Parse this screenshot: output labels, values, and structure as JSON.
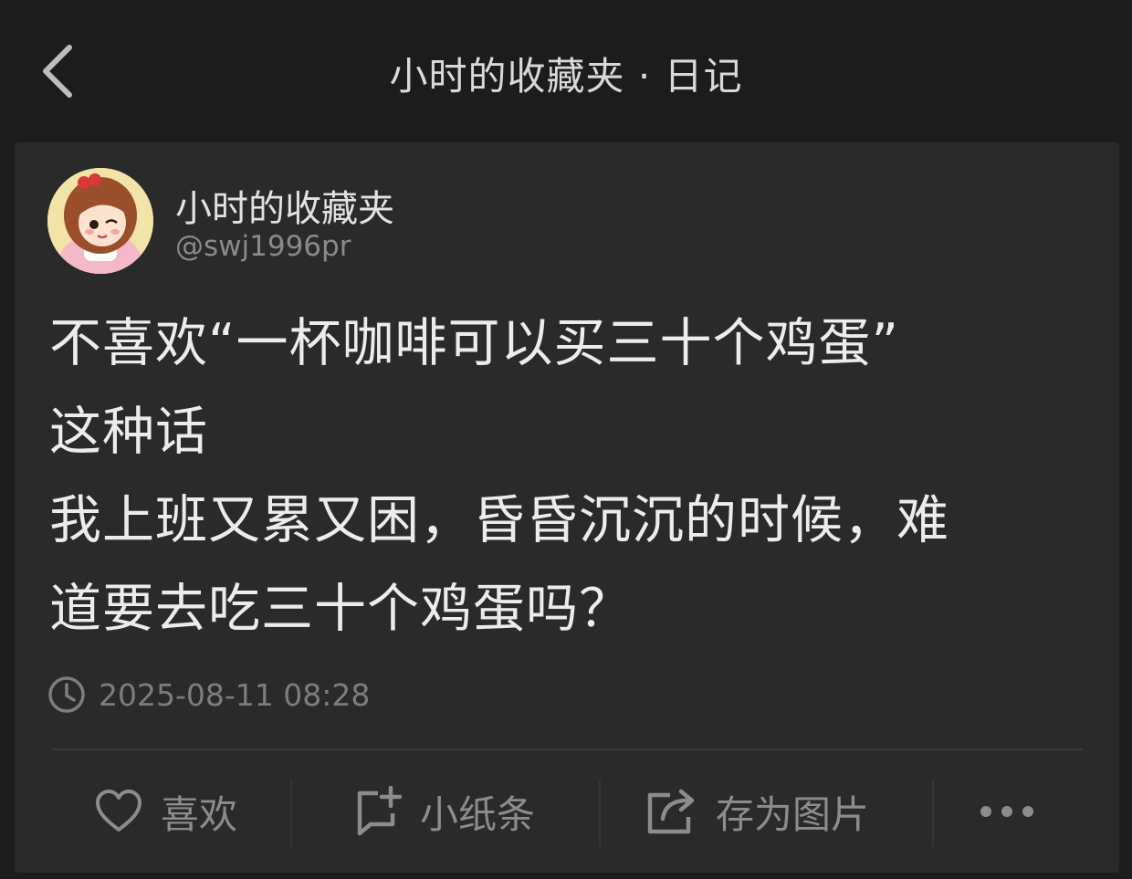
{
  "nav": {
    "title": "小时的收藏夹 · 日记"
  },
  "author": {
    "name": "小时的收藏夹",
    "handle": "@swj1996pr"
  },
  "post": {
    "lines": [
      "不喜欢“一杯咖啡可以买三十个鸡蛋”",
      "这种话",
      "我上班又累又困，昏昏沉沉的时候，难",
      "道要去吃三十个鸡蛋吗？"
    ],
    "timestamp": "2025-08-11 08:28"
  },
  "actions": {
    "like": "喜欢",
    "note": "小纸条",
    "save_image": "存为图片"
  },
  "icons": [
    "back-icon",
    "clock-icon",
    "heart-icon",
    "note-add-icon",
    "share-icon",
    "more-icon"
  ],
  "colors": {
    "background": "#1c1c1c",
    "card": "#2a2a2a",
    "text": "#ececec",
    "muted": "#8c8c8c"
  }
}
